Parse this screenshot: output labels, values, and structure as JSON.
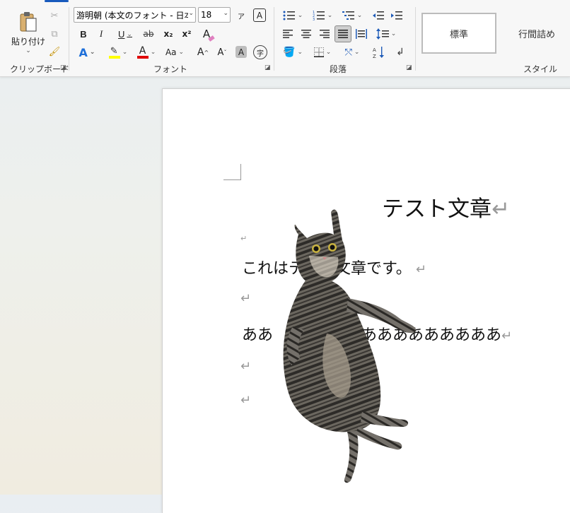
{
  "ribbon": {
    "clipboard": {
      "paste_label": "貼り付け",
      "group_label": "クリップボード"
    },
    "font": {
      "font_name": "游明朝 (本文のフォント - 日本語)",
      "font_size": "18",
      "bold": "B",
      "italic": "I",
      "underline": "U",
      "strike": "ab",
      "subscript": "x₂",
      "superscript": "x²",
      "change_case": "Aa",
      "grow_font": "A",
      "shrink_font": "A",
      "char_shade": "A",
      "enclose_char": "字",
      "clear_format": "A",
      "phonetic": "ア",
      "char_border": "A",
      "group_label": "フォント",
      "highlight_color": "#ffff00",
      "font_color": "#e00000"
    },
    "paragraph": {
      "group_label": "段落"
    },
    "styles": {
      "items": [
        "標準",
        "行間詰め"
      ],
      "group_label": "スタイル"
    }
  },
  "document": {
    "title": "テスト文章",
    "line1": "これはテスト文章です。",
    "line3_left": "ああ",
    "line3_right": "あああああああああ",
    "paragraph_mark": "↵"
  },
  "image": {
    "subject": "cat-photo"
  },
  "colors": {
    "accent": "#185abd"
  }
}
